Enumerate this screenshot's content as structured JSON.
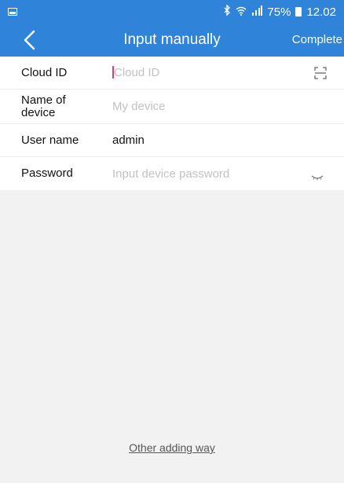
{
  "status_bar": {
    "bluetooth_icon": "bluetooth-icon",
    "wifi_icon": "wifi-icon",
    "signal_icon": "signal-icon",
    "battery_percent": "75%",
    "time": "12.02"
  },
  "header": {
    "title": "Input manually",
    "complete_label": "Complete",
    "back_icon": "back-arrow-icon"
  },
  "form": {
    "cloud_id": {
      "label": "Cloud ID",
      "placeholder": "Cloud ID",
      "value": ""
    },
    "device_name": {
      "label": "Name of device",
      "placeholder": "My device",
      "value": ""
    },
    "user_name": {
      "label": "User name",
      "value": "admin"
    },
    "password": {
      "label": "Password",
      "placeholder": "Input device password",
      "value": ""
    }
  },
  "footer": {
    "other_adding_way": "Other adding way"
  },
  "colors": {
    "primary": "#2f83d8",
    "background": "#f2f2f2",
    "cursor": "#e73a6b"
  }
}
